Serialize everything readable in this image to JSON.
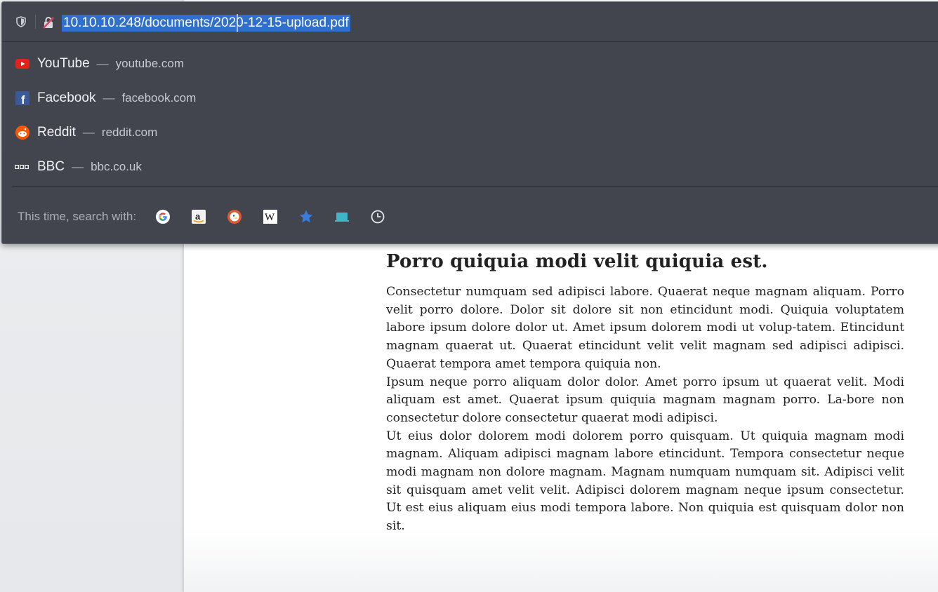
{
  "urlbar": {
    "url": "10.10.10.248/documents/2020-12-15-upload.pdf"
  },
  "suggestions": [
    {
      "title": "YouTube",
      "url": "youtube.com",
      "icon": "youtube-icon"
    },
    {
      "title": "Facebook",
      "url": "facebook.com",
      "icon": "facebook-icon"
    },
    {
      "title": "Reddit",
      "url": "reddit.com",
      "icon": "reddit-icon"
    },
    {
      "title": "BBC",
      "url": "bbc.co.uk",
      "icon": "bbc-icon"
    }
  ],
  "separator": "—",
  "search_with": {
    "label": "This time, search with:",
    "engines": [
      "google-icon",
      "amazon-icon",
      "duckduckgo-icon",
      "wikipedia-icon",
      "bookmarks-icon",
      "tabs-icon",
      "history-icon"
    ]
  },
  "document": {
    "title": "Porro quiquia modi velit quiquia est.",
    "paragraphs": [
      "Consectetur numquam sed adipisci labore. Quaerat neque magnam aliquam. Porro velit porro dolore. Dolor sit dolore sit non etincidunt modi. Quiquia voluptatem labore ipsum dolore dolor ut. Amet ipsum dolorem modi ut volup-tatem. Etincidunt magnam quaerat ut. Quaerat etincidunt velit velit magnam sed adipisci adipisci. Quaerat tempora amet tempora quiquia non.",
      "Ipsum neque porro aliquam dolor dolor. Amet porro ipsum ut quaerat velit. Modi aliquam est amet. Quaerat ipsum quiquia magnam magnam porro. La-bore non consectetur dolore consectetur quaerat modi adipisci.",
      "Ut eius dolor dolorem modi dolorem porro quisquam. Ut quiquia magnam modi magnam. Aliquam adipisci magnam labore etincidunt. Tempora consectetur neque modi magnam non dolore magnam. Magnam numquam numquam sit. Adipisci velit sit quisquam amet velit velit. Adipisci dolorem magnam neque ipsum consectetur. Ut est eius aliquam eius modi tempora labore. Non quiquia est quisquam dolor non sit."
    ]
  },
  "colors": {
    "panel_bg": "#42454e",
    "url_highlight": "#2f6fcd",
    "youtube": "#e62117",
    "facebook": "#3b5998",
    "reddit": "#ff5700"
  }
}
